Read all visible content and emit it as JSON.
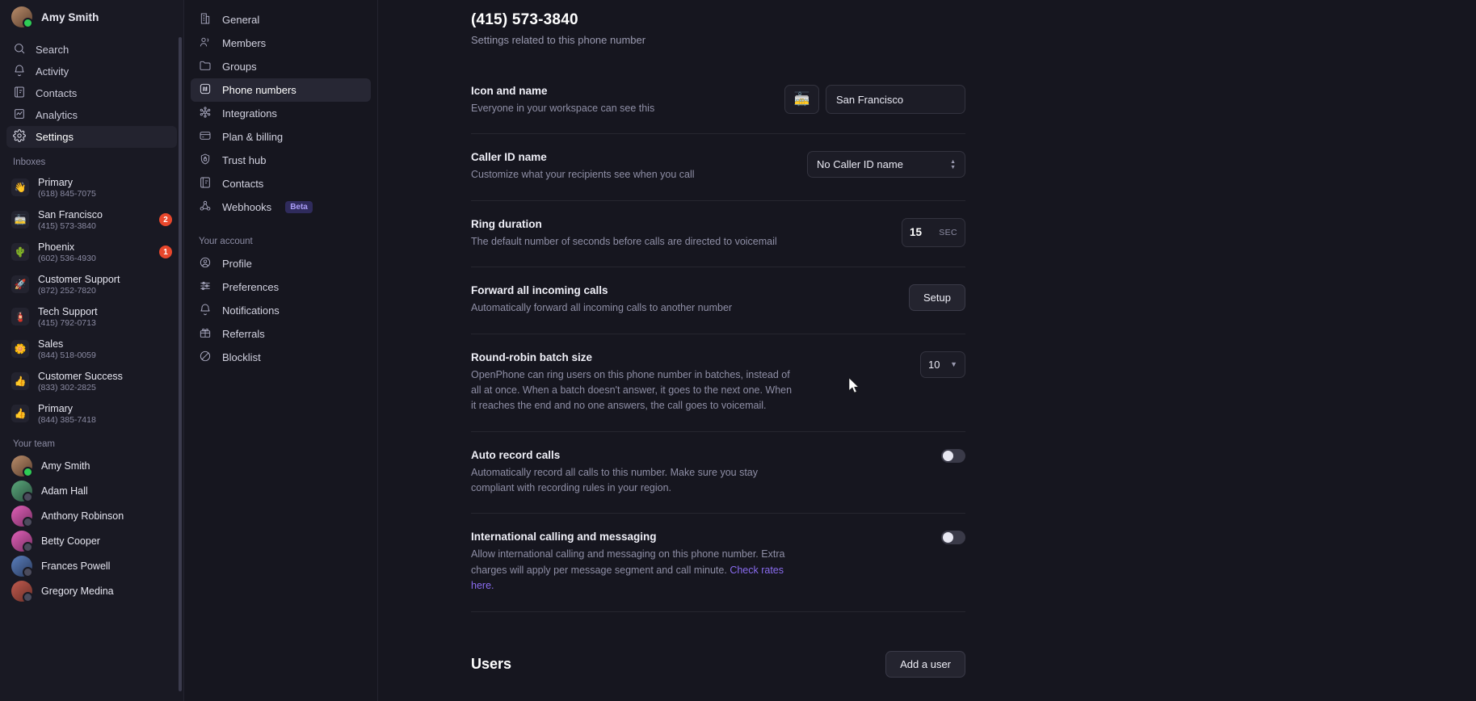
{
  "rail": {
    "user": {
      "name": "Amy Smith",
      "status": "online"
    },
    "nav": [
      {
        "label": "Search",
        "icon": "search-icon",
        "active": false
      },
      {
        "label": "Activity",
        "icon": "bell-icon",
        "active": false
      },
      {
        "label": "Contacts",
        "icon": "contacts-icon",
        "active": false
      },
      {
        "label": "Analytics",
        "icon": "analytics-icon",
        "active": false
      },
      {
        "label": "Settings",
        "icon": "gear-icon",
        "active": true
      }
    ],
    "inboxes_label": "Inboxes",
    "inboxes": [
      {
        "name": "Primary",
        "number": "(618) 845-7075",
        "emoji": "👋",
        "badge": ""
      },
      {
        "name": "San Francisco",
        "number": "(415) 573-3840",
        "emoji": "🚋",
        "badge": "2"
      },
      {
        "name": "Phoenix",
        "number": "(602) 536-4930",
        "emoji": "🌵",
        "badge": "1"
      },
      {
        "name": "Customer Support",
        "number": "(872) 252-7820",
        "emoji": "🚀",
        "badge": ""
      },
      {
        "name": "Tech Support",
        "number": "(415) 792-0713",
        "emoji": "🧯",
        "badge": ""
      },
      {
        "name": "Sales",
        "number": "(844) 518-0059",
        "emoji": "🌼",
        "badge": ""
      },
      {
        "name": "Customer Success",
        "number": "(833) 302-2825",
        "emoji": "👍",
        "badge": ""
      },
      {
        "name": "Primary",
        "number": "(844) 385-7418",
        "emoji": "👍",
        "badge": ""
      }
    ],
    "team_label": "Your team",
    "team": [
      {
        "name": "Amy Smith",
        "status": "online",
        "tint": "tan"
      },
      {
        "name": "Adam Hall",
        "status": "offline",
        "tint": "green"
      },
      {
        "name": "Anthony Robinson",
        "status": "offline",
        "tint": "pink"
      },
      {
        "name": "Betty Cooper",
        "status": "offline",
        "tint": "pink"
      },
      {
        "name": "Frances Powell",
        "status": "offline",
        "tint": "blue"
      },
      {
        "name": "Gregory Medina",
        "status": "offline",
        "tint": "red"
      }
    ]
  },
  "subnav": {
    "workspace_items": [
      {
        "label": "General",
        "icon": "building-icon",
        "active": false
      },
      {
        "label": "Members",
        "icon": "people-icon",
        "active": false
      },
      {
        "label": "Groups",
        "icon": "folder-icon",
        "active": false
      },
      {
        "label": "Phone numbers",
        "icon": "hash-square-icon",
        "active": true
      },
      {
        "label": "Integrations",
        "icon": "integrations-icon",
        "active": false
      },
      {
        "label": "Plan & billing",
        "icon": "card-icon",
        "active": false
      },
      {
        "label": "Trust hub",
        "icon": "shield-lock-icon",
        "active": false
      },
      {
        "label": "Contacts",
        "icon": "contacts-icon",
        "active": false
      },
      {
        "label": "Webhooks",
        "icon": "webhook-icon",
        "active": false,
        "badge": "Beta"
      }
    ],
    "account_label": "Your account",
    "account_items": [
      {
        "label": "Profile",
        "icon": "profile-icon",
        "active": false
      },
      {
        "label": "Preferences",
        "icon": "sliders-icon",
        "active": false
      },
      {
        "label": "Notifications",
        "icon": "bell-icon",
        "active": false
      },
      {
        "label": "Referrals",
        "icon": "gift-icon",
        "active": false
      },
      {
        "label": "Blocklist",
        "icon": "block-icon",
        "active": false
      }
    ]
  },
  "main": {
    "title": "(415) 573-3840",
    "subtitle": "Settings related to this phone number",
    "rows": {
      "icon_and_name": {
        "title": "Icon and name",
        "desc": "Everyone in your workspace can see this",
        "emoji": "🚋",
        "value": "San Francisco"
      },
      "caller_id": {
        "title": "Caller ID name",
        "desc": "Customize what your recipients see when you call",
        "value": "No Caller ID name"
      },
      "ring_duration": {
        "title": "Ring duration",
        "desc": "The default number of seconds before calls are directed to voicemail",
        "value": "15",
        "unit": "SEC"
      },
      "forward_calls": {
        "title": "Forward all incoming calls",
        "desc": "Automatically forward all incoming calls to another number",
        "button": "Setup"
      },
      "round_robin": {
        "title": "Round-robin batch size",
        "desc": "OpenPhone can ring users on this phone number in batches, instead of all at once. When a batch doesn't answer, it goes to the next one. When it reaches the end and no one answers, the call goes to voicemail.",
        "value": "10"
      },
      "auto_record": {
        "title": "Auto record calls",
        "desc": "Automatically record all calls to this number. Make sure you stay compliant with recording rules in your region.",
        "enabled": false
      },
      "international": {
        "title": "International calling and messaging",
        "desc_part1": "Allow international calling and messaging on this phone number. Extra charges will apply per message segment and call minute. ",
        "link_text": "Check rates here.",
        "enabled": false
      }
    },
    "users_section": {
      "title": "Users",
      "add_button": "Add a user"
    }
  },
  "colors": {
    "accent": "#6c5ce7",
    "link": "#8a6cf0",
    "badge": "#e8472c",
    "online": "#2ecc55"
  }
}
